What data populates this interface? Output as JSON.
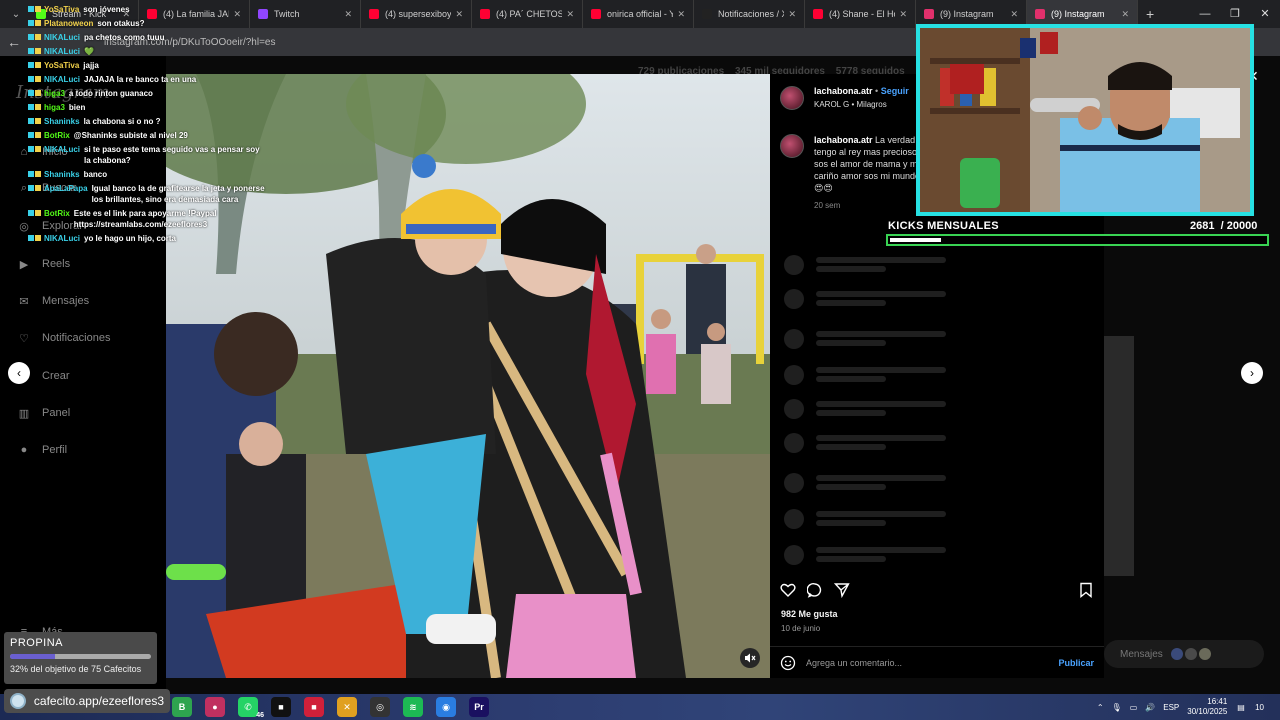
{
  "browser": {
    "tabs": [
      {
        "title": "Stream - Kick",
        "color": "#53fc18",
        "active": false
      },
      {
        "title": "(4) La familia JAIT",
        "color": "#ff0033",
        "active": false
      },
      {
        "title": "Twitch",
        "color": "#9146ff",
        "active": false
      },
      {
        "title": "(4) supersexiboys",
        "color": "#ff0033",
        "active": false
      },
      {
        "title": "(4) PA´ CHETOS C",
        "color": "#ff0033",
        "active": false
      },
      {
        "title": "onirica official - Y",
        "color": "#ff0033",
        "active": false
      },
      {
        "title": "Notificaciones / X",
        "color": "#222222",
        "active": false
      },
      {
        "title": "(4) Shane - El Hom",
        "color": "#ff0033",
        "active": false
      },
      {
        "title": "(9) Instagram",
        "color": "#e1306c",
        "active": false
      },
      {
        "title": "(9) Instagram",
        "color": "#e1306c",
        "active": true
      }
    ],
    "url": "instagram.com/p/DKuToOOoeir/?hl=es"
  },
  "instagram": {
    "logo": "Instagram",
    "profile_stats": {
      "posts": "729 publicaciones",
      "followers": "345 mil seguidores",
      "following": "5778 seguidos"
    },
    "nav": [
      {
        "label": "Inicio",
        "icon": "home-icon"
      },
      {
        "label": "Buscar",
        "icon": "search-icon"
      },
      {
        "label": "Explorar",
        "icon": "compass-icon"
      },
      {
        "label": "Reels",
        "icon": "reels-icon"
      },
      {
        "label": "Mensajes",
        "icon": "messenger-icon"
      },
      {
        "label": "Notificaciones",
        "icon": "heart-icon"
      },
      {
        "label": "Crear",
        "icon": "plus-icon"
      },
      {
        "label": "Panel",
        "icon": "chart-icon"
      },
      {
        "label": "Perfil",
        "icon": "avatar-icon"
      },
      {
        "label": "Más",
        "icon": "menu-icon"
      }
    ],
    "post": {
      "author": "lachabona.atr",
      "follow_label": "Seguir",
      "song": "KAROL G • Milagros",
      "caption_author": "lachabona.atr",
      "caption": "La verdad tengo al rey mas precioso sos el amor de mama y mi cariño amor sos mi mundo",
      "caption_emojis": "😍😍",
      "caption_time": "20 sem",
      "likes": "982 Me gusta",
      "date": "10 de junio",
      "comment_placeholder": "Agrega un comentario...",
      "publish_label": "Publicar"
    },
    "messages_pill": "Mensajes"
  },
  "chat": [
    {
      "user": "YoSaTiva",
      "color": "#f2d24b",
      "text": "son jóvenes"
    },
    {
      "user": "Platanoweon",
      "color": "#f2d24b",
      "text": "son otakus?"
    },
    {
      "user": "NIKALuci",
      "color": "#3ad1e8",
      "text": "pa chetos como tuuu"
    },
    {
      "user": "NIKALuci",
      "color": "#3ad1e8",
      "text": "💚"
    },
    {
      "user": "YoSaTiva",
      "color": "#f2d24b",
      "text": "jajja"
    },
    {
      "user": "NIKALuci",
      "color": "#3ad1e8",
      "text": "JAJAJA la re banco ta en una"
    },
    {
      "user": "higa3",
      "color": "#53fc18",
      "text": "a todo rinton guanaco"
    },
    {
      "user": "higa3",
      "color": "#53fc18",
      "text": "bien"
    },
    {
      "user": "Shaninks",
      "color": "#3ad1e8",
      "text": "la chabona si o no ?"
    },
    {
      "user": "BotRix",
      "color": "#53fc18",
      "text": "@Shaninks subiste al nivel 29"
    },
    {
      "user": "NIKALuci",
      "color": "#3ad1e8",
      "text": "si te paso este tema seguido vas a pensar soy la chabona?"
    },
    {
      "user": "Shaninks",
      "color": "#3ad1e8",
      "text": "banco"
    },
    {
      "user": "ApaLaPapa",
      "color": "#3ad1e8",
      "text": "Igual banco la de grafitearse la jeta y ponerse los brillantes, sino era demasiada cara"
    },
    {
      "user": "BotRix",
      "color": "#53fc18",
      "text": "Este es el link para apoyarme !Paypal https://streamlabs.com/ezeeflores3"
    },
    {
      "user": "NIKALuci",
      "color": "#3ad1e8",
      "text": "yo le hago un hijo, corta"
    }
  ],
  "kicks": {
    "label": "KICKS MENSUALES",
    "current": "2681",
    "goal": "/ 20000",
    "fraction": 0.134
  },
  "tip": {
    "title": "PROPINA",
    "fraction": 0.32,
    "text": "32% del objetivo de 75 Cafecitos"
  },
  "cafecito": {
    "url": "cafecito.app/ezeeflores3"
  },
  "taskbar": {
    "icons": [
      {
        "name": "app-b-icon",
        "glyph": "B",
        "color": "#2ea44f"
      },
      {
        "name": "app-chat-icon",
        "glyph": "●",
        "color": "#c03060"
      },
      {
        "name": "whatsapp-icon",
        "glyph": "✆",
        "color": "#25d366",
        "badge": "46"
      },
      {
        "name": "app-dark-icon",
        "glyph": "■",
        "color": "#111111"
      },
      {
        "name": "app-red-icon",
        "glyph": "■",
        "color": "#d0203a"
      },
      {
        "name": "app-cross-icon",
        "glyph": "✕",
        "color": "#e0a020"
      },
      {
        "name": "app-circle-icon",
        "glyph": "◎",
        "color": "#333333"
      },
      {
        "name": "spotify-icon",
        "glyph": "≋",
        "color": "#1db954"
      },
      {
        "name": "app-blue-icon",
        "glyph": "◉",
        "color": "#2a7de1"
      },
      {
        "name": "premiere-icon",
        "glyph": "Pr",
        "color": "#1a1060"
      }
    ],
    "lang": "ESP",
    "time": "16:41",
    "date": "30/10/2025",
    "notif_count": "10"
  }
}
